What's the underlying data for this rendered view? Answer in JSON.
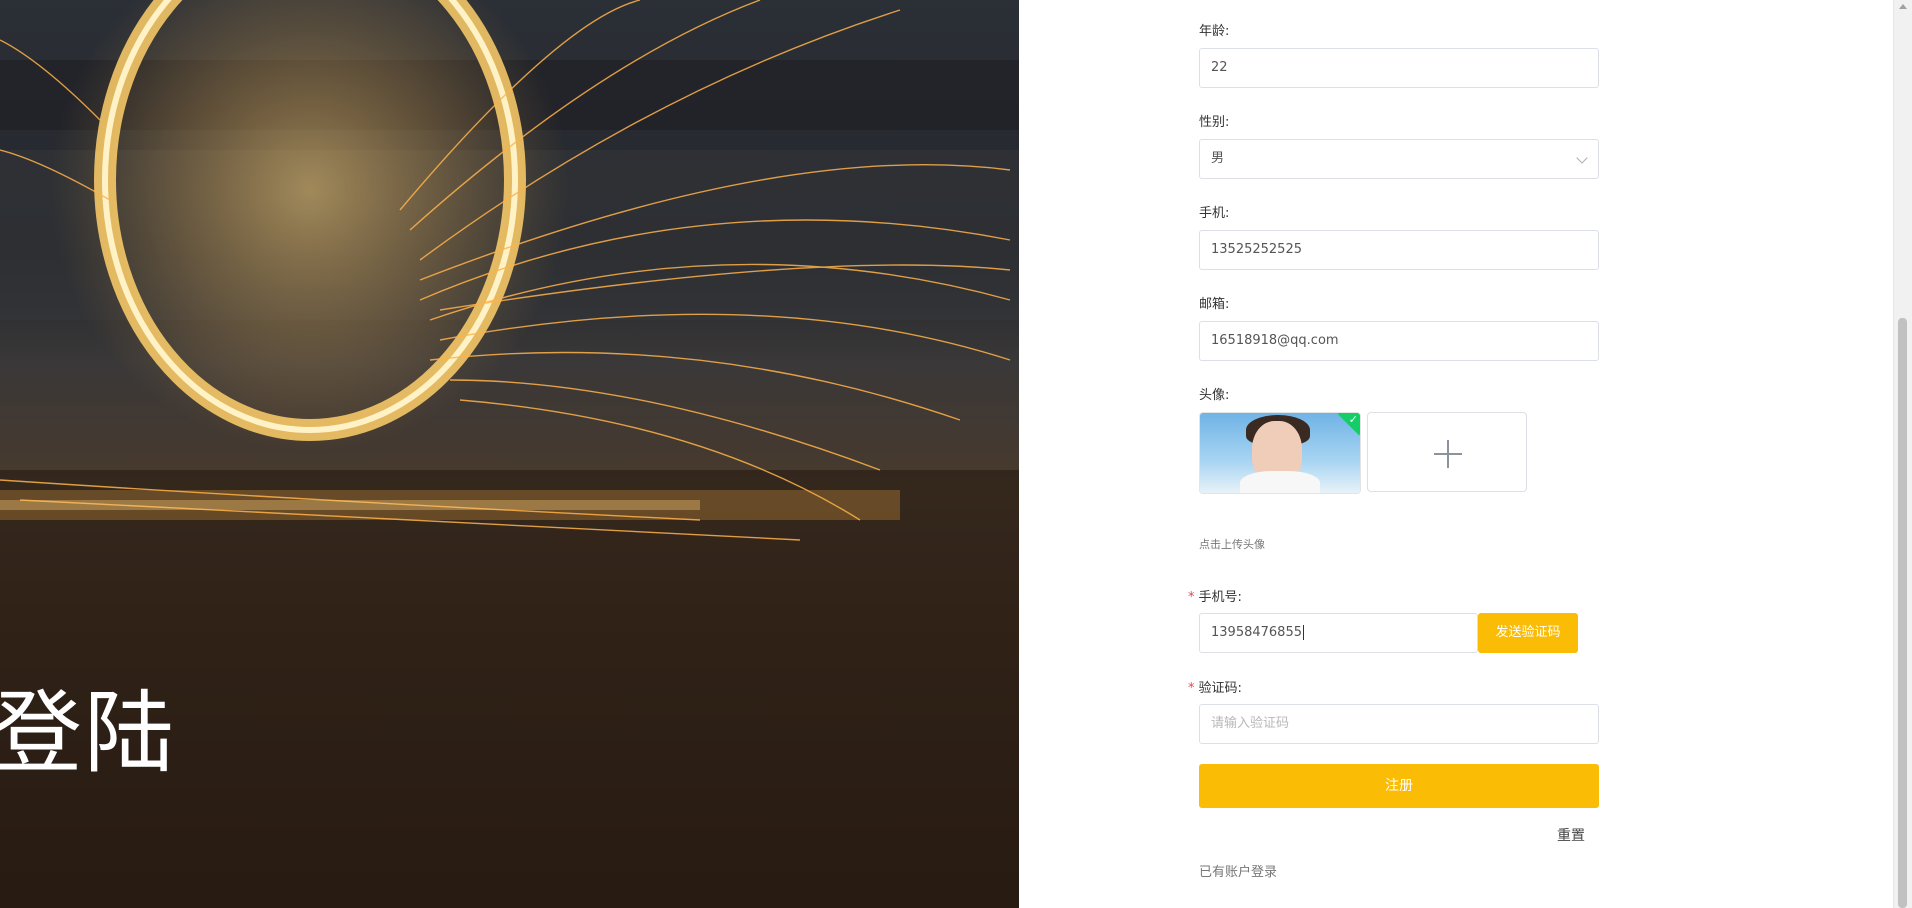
{
  "hero": {
    "title": "登陆"
  },
  "form": {
    "age": {
      "label": "年龄:",
      "value": "22"
    },
    "gender": {
      "label": "性别:",
      "value": "男"
    },
    "mobile": {
      "label": "手机:",
      "value": "13525252525"
    },
    "email": {
      "label": "邮箱:",
      "value": "16518918@qq.com"
    },
    "avatar": {
      "label": "头像:",
      "hint": "点击上传头像"
    },
    "phone": {
      "label": "手机号:",
      "value": "13958476855",
      "send_label": "发送验证码"
    },
    "code": {
      "label": "验证码:",
      "placeholder": "请输入验证码"
    },
    "submit_label": "注册",
    "reset_label": "重置",
    "login_link": "已有账户登录"
  },
  "colors": {
    "accent": "#fbbc05",
    "required": "#e5484d",
    "upload_success": "#13ce66"
  },
  "icons": {
    "gender_dropdown": "chevron-down-icon",
    "upload": "plus-icon",
    "upload_success": "check-icon"
  }
}
